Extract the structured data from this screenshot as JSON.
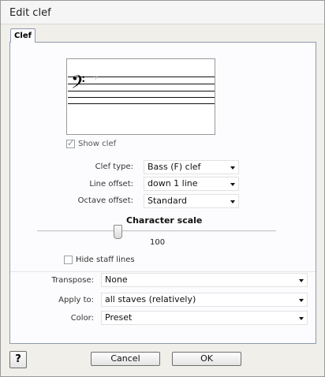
{
  "dialog": {
    "title": "Edit clef",
    "tab": "Clef",
    "preview": {
      "clef_glyph": "𝄢",
      "ghost_glyph": "𝄢"
    },
    "show_clef": {
      "label": "Show clef",
      "checked": true
    },
    "clef_type": {
      "label": "Clef type:",
      "value": "Bass (F) clef"
    },
    "line_offset": {
      "label": "Line offset:",
      "value": "down 1 line"
    },
    "octave_offset": {
      "label": "Octave offset:",
      "value": "Standard"
    },
    "character_scale": {
      "heading": "Character scale",
      "value": "100",
      "level": 0.33
    },
    "hide_staff_lines": {
      "label": "Hide staff lines",
      "checked": false
    },
    "transpose": {
      "label": "Transpose:",
      "value": "None"
    },
    "apply_to": {
      "label": "Apply to:",
      "value": "all staves (relatively)"
    },
    "color": {
      "label": "Color:",
      "value": "Preset"
    }
  },
  "buttons": {
    "help": "?",
    "cancel": "Cancel",
    "ok": "OK"
  },
  "icons": {
    "help": "help-icon",
    "dropdown": "chevron-down-icon",
    "check": "checkmark-icon"
  }
}
